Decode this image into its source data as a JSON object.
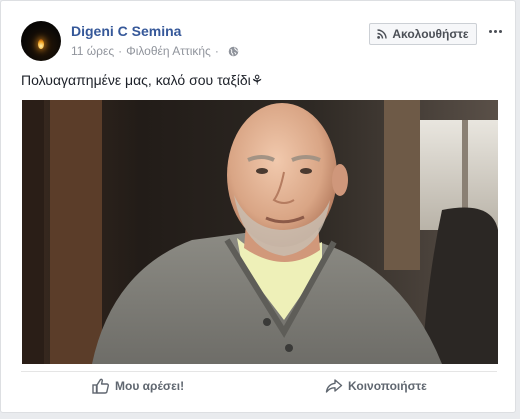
{
  "post": {
    "author": "Digeni C Semina",
    "time": "11 ώρες",
    "separator": "·",
    "location": "Φιλοθέη Αττικής",
    "text": "Πολυαγαπημένε μας, καλό σου ταξίδι⚘"
  },
  "header": {
    "follow_label": "Ακολουθήστε",
    "icons": {
      "follow": "rss-icon",
      "audience": "globe-icon",
      "more": "more-options-icon"
    }
  },
  "actions": {
    "like_label": "Μου αρέσει!",
    "share_label": "Κοινοποιήστε",
    "icons": {
      "like": "thumbs-up-icon",
      "share": "share-arrow-icon"
    }
  },
  "colors": {
    "link": "#365899",
    "secondary_text": "#90949c",
    "action_text": "#606770",
    "card_bg": "#ffffff",
    "page_bg": "#e9ebee"
  }
}
